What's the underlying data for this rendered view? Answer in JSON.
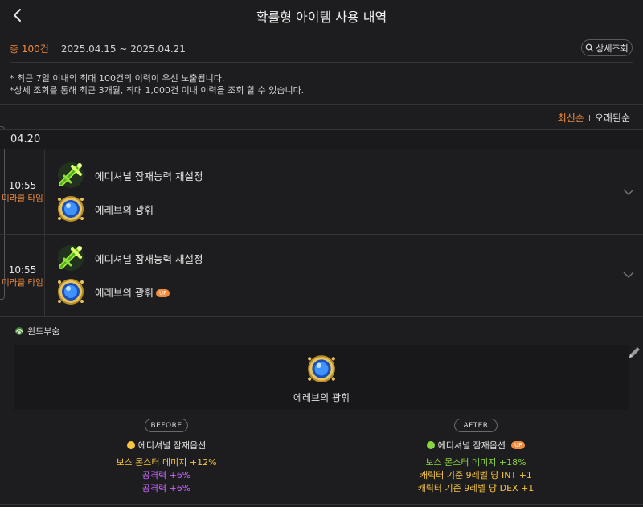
{
  "header": {
    "title": "확률형 아이템 사용 내역"
  },
  "summary": {
    "total": "총 100건",
    "period": "2025.04.15 ~ 2025.04.21",
    "detail_button": "상세조회"
  },
  "notes": [
    "* 최근 7일 이내의 최대 100건의 이력이 우선 노출됩니다.",
    "*상세 조회를 통해 최근 3개월, 최대 1,000건 이내 이력을 조회 할 수 있습니다."
  ],
  "sort": {
    "newest": "최신순",
    "oldest": "오래된순"
  },
  "date_group": "04.20",
  "rows": [
    {
      "time": "10:55",
      "server": "미라클 타임",
      "cube_name": "에디셔널 잠재능력 재설정",
      "item_name": "에레브의 광휘",
      "badge": ""
    },
    {
      "time": "10:55",
      "server": "미라클 타임",
      "cube_name": "에디셔널 잠재능력 재설정",
      "item_name": "에레브의 광휘",
      "badge": "UP"
    }
  ],
  "detail": {
    "world": "윈드부숨",
    "item_name": "에레브의 광휘",
    "before": {
      "label": "BEFORE",
      "grade": "에디셔널 잠재옵션",
      "lines": [
        "보스 몬스터 데미지 +12%",
        "공격력 +6%",
        "공격력 +6%"
      ]
    },
    "after": {
      "label": "AFTER",
      "grade": "에디셔널 잠재옵션",
      "badge": "UP",
      "lines": [
        "보스 몬스터 데미지 +18%",
        "캐릭터 기준 9레벨 당 INT +1",
        "캐릭터 기준 9레벨 당 DEX +1"
      ]
    }
  },
  "colors": {
    "accent_orange": "#f08a3c",
    "epic_purple": "#c865ff",
    "unique_gold": "#f5c542",
    "legendary_green": "#8ad43f"
  },
  "icons": {
    "cube": "green-sword-icon",
    "emblem": "erebs-radiance-emblem-icon"
  }
}
